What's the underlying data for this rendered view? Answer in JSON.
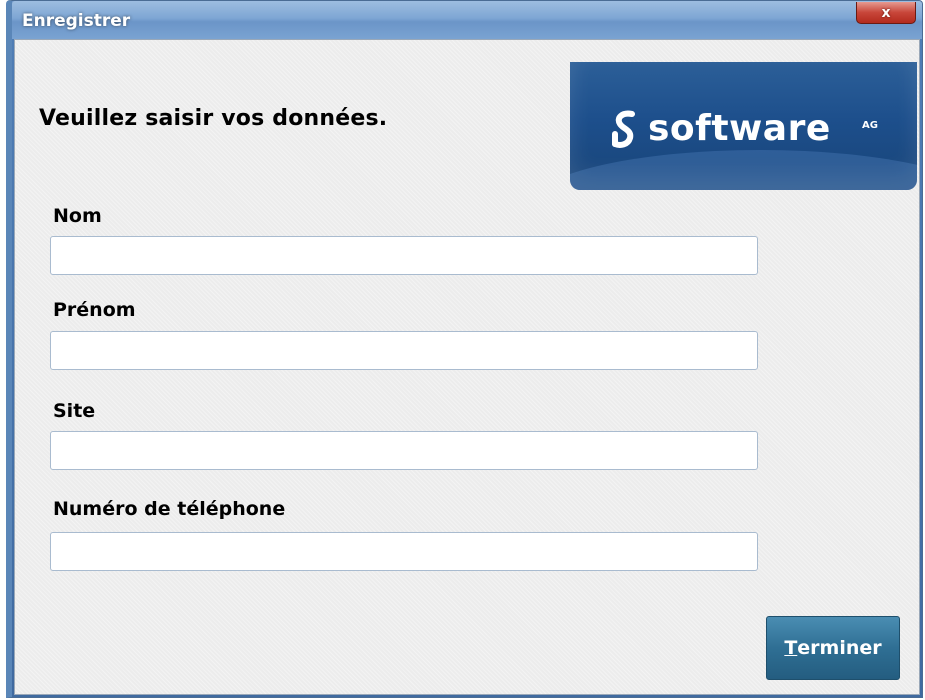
{
  "window": {
    "title": "Enregistrer",
    "close_label": "x"
  },
  "form": {
    "heading": "Veuillez saisir vos données.",
    "fields": [
      {
        "label": "Nom",
        "value": "",
        "placeholder": ""
      },
      {
        "label": "Prénom",
        "value": "",
        "placeholder": ""
      },
      {
        "label": "Site",
        "value": "",
        "placeholder": ""
      },
      {
        "label": "Numéro de téléphone",
        "value": "",
        "placeholder": ""
      }
    ],
    "finish_mnemonic": "T",
    "finish_rest": "erminer"
  },
  "logo": {
    "word": "software",
    "suffix": "AG"
  },
  "icons": {
    "logo_mark": "software-ag-s-mark-icon",
    "close": "close-icon"
  },
  "colors": {
    "title_bar": "#7ea6d4",
    "close_button": "#c8463a",
    "logo_background": "#1d4f8c",
    "finish_button": "#2f6f94",
    "client_background": "#ececec"
  }
}
